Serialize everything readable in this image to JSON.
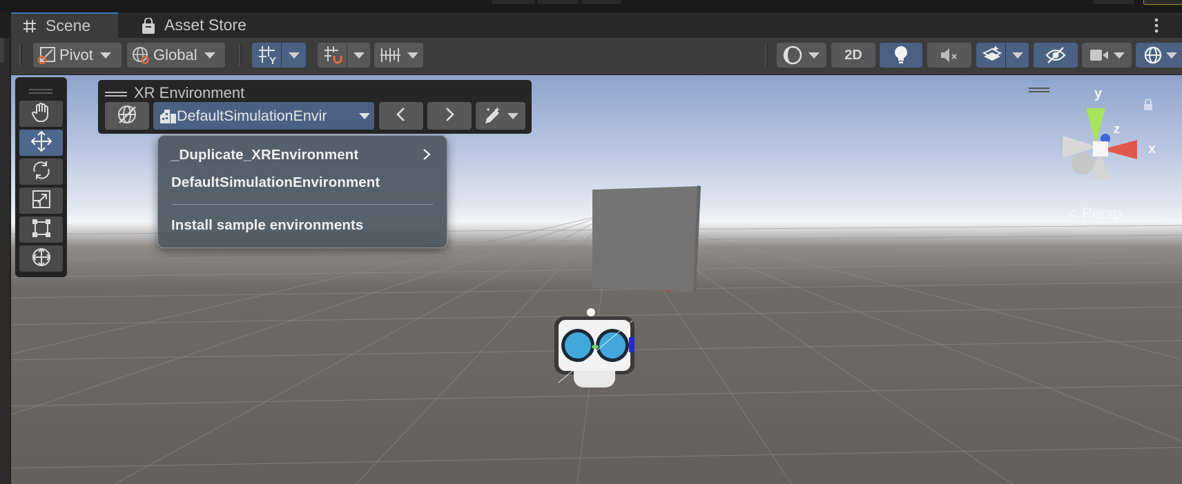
{
  "tabs": [
    {
      "label": "Scene",
      "icon": "grid-icon",
      "active": true
    },
    {
      "label": "Asset Store",
      "icon": "shopping-bag-icon",
      "active": false
    }
  ],
  "toolbar": {
    "pivot_label": "Pivot",
    "global_label": "Global",
    "view_2d_label": "2D"
  },
  "xr_environment": {
    "title": "XR Environment",
    "selected_environment": "DefaultSimulationEnvir",
    "menu": {
      "items": [
        {
          "label": "_Duplicate_XREnvironment",
          "submenu": true
        },
        {
          "label": "DefaultSimulationEnvironment",
          "submenu": false
        },
        {
          "label": "Install sample environments",
          "submenu": false
        }
      ]
    }
  },
  "gizmo": {
    "y_label": "y",
    "z_label": "z",
    "x_label": "x",
    "projection_label": "Persp"
  },
  "colors": {
    "active_blue": "#4a6183",
    "toolbar_bg": "#3c3c3c",
    "accent_tab": "#3a79bb"
  }
}
